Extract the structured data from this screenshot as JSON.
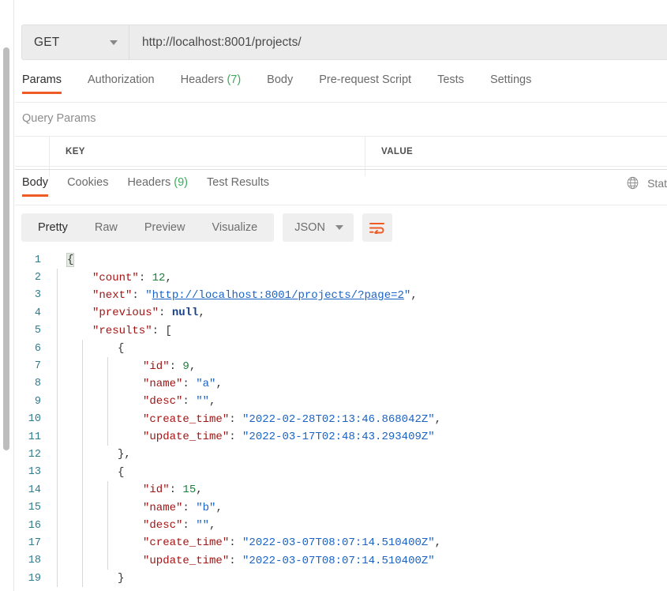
{
  "request": {
    "method": "GET",
    "url": "http://localhost:8001/projects/",
    "tabs": [
      {
        "label": "Params",
        "count": null,
        "active": true
      },
      {
        "label": "Authorization",
        "count": null,
        "active": false
      },
      {
        "label": "Headers",
        "count": "(7)",
        "active": false
      },
      {
        "label": "Body",
        "count": null,
        "active": false
      },
      {
        "label": "Pre-request Script",
        "count": null,
        "active": false
      },
      {
        "label": "Tests",
        "count": null,
        "active": false
      },
      {
        "label": "Settings",
        "count": null,
        "active": false
      }
    ],
    "query_params": {
      "title": "Query Params",
      "columns": [
        "KEY",
        "VALUE"
      ]
    }
  },
  "response": {
    "tabs": [
      {
        "label": "Body",
        "count": null,
        "active": true
      },
      {
        "label": "Cookies",
        "count": null,
        "active": false
      },
      {
        "label": "Headers",
        "count": "(9)",
        "active": false
      },
      {
        "label": "Test Results",
        "count": null,
        "active": false
      }
    ],
    "status_text": "Stat",
    "format_tabs": [
      {
        "label": "Pretty",
        "active": true
      },
      {
        "label": "Raw",
        "active": false
      },
      {
        "label": "Preview",
        "active": false
      },
      {
        "label": "Visualize",
        "active": false
      }
    ],
    "language": "JSON",
    "body_json": {
      "count": 12,
      "next": "http://localhost:8001/projects/?page=2",
      "previous": null,
      "results": [
        {
          "id": 9,
          "name": "a",
          "desc": "",
          "create_time": "2022-02-28T02:13:46.868042Z",
          "update_time": "2022-03-17T02:48:43.293409Z"
        },
        {
          "id": 15,
          "name": "b",
          "desc": "",
          "create_time": "2022-03-07T08:07:14.510400Z",
          "update_time": "2022-03-07T08:07:14.510400Z"
        }
      ]
    },
    "code_lines": [
      {
        "n": 1,
        "indent": 0,
        "guides": 0,
        "html": "<span class=\"tok-punc brace-hl\">{</span>"
      },
      {
        "n": 2,
        "indent": 1,
        "guides": 1,
        "html": "<span class=\"tok-key\">\"count\"</span><span class=\"tok-punc\">: </span><span class=\"tok-num\">12</span><span class=\"tok-punc\">,</span>"
      },
      {
        "n": 3,
        "indent": 1,
        "guides": 1,
        "html": "<span class=\"tok-key\">\"next\"</span><span class=\"tok-punc\">: </span><span class=\"tok-str\">\"</span><span class=\"tok-link\">http://localhost:8001/projects/?page=2</span><span class=\"tok-str\">\"</span><span class=\"tok-punc\">,</span>"
      },
      {
        "n": 4,
        "indent": 1,
        "guides": 1,
        "html": "<span class=\"tok-key\">\"previous\"</span><span class=\"tok-punc\">: </span><span class=\"tok-null\">null</span><span class=\"tok-punc\">,</span>"
      },
      {
        "n": 5,
        "indent": 1,
        "guides": 1,
        "html": "<span class=\"tok-key\">\"results\"</span><span class=\"tok-punc\">: [</span>"
      },
      {
        "n": 6,
        "indent": 2,
        "guides": 2,
        "html": "<span class=\"tok-punc\">{</span>"
      },
      {
        "n": 7,
        "indent": 3,
        "guides": 3,
        "html": "<span class=\"tok-key\">\"id\"</span><span class=\"tok-punc\">: </span><span class=\"tok-num\">9</span><span class=\"tok-punc\">,</span>"
      },
      {
        "n": 8,
        "indent": 3,
        "guides": 3,
        "html": "<span class=\"tok-key\">\"name\"</span><span class=\"tok-punc\">: </span><span class=\"tok-str\">\"a\"</span><span class=\"tok-punc\">,</span>"
      },
      {
        "n": 9,
        "indent": 3,
        "guides": 3,
        "html": "<span class=\"tok-key\">\"desc\"</span><span class=\"tok-punc\">: </span><span class=\"tok-str\">\"\"</span><span class=\"tok-punc\">,</span>"
      },
      {
        "n": 10,
        "indent": 3,
        "guides": 3,
        "html": "<span class=\"tok-key\">\"create_time\"</span><span class=\"tok-punc\">: </span><span class=\"tok-str\">\"2022-02-28T02:13:46.868042Z\"</span><span class=\"tok-punc\">,</span>"
      },
      {
        "n": 11,
        "indent": 3,
        "guides": 3,
        "html": "<span class=\"tok-key\">\"update_time\"</span><span class=\"tok-punc\">: </span><span class=\"tok-str\">\"2022-03-17T02:48:43.293409Z\"</span>"
      },
      {
        "n": 12,
        "indent": 2,
        "guides": 2,
        "html": "<span class=\"tok-punc\">},</span>"
      },
      {
        "n": 13,
        "indent": 2,
        "guides": 2,
        "html": "<span class=\"tok-punc\">{</span>"
      },
      {
        "n": 14,
        "indent": 3,
        "guides": 3,
        "html": "<span class=\"tok-key\">\"id\"</span><span class=\"tok-punc\">: </span><span class=\"tok-num\">15</span><span class=\"tok-punc\">,</span>"
      },
      {
        "n": 15,
        "indent": 3,
        "guides": 3,
        "html": "<span class=\"tok-key\">\"name\"</span><span class=\"tok-punc\">: </span><span class=\"tok-str\">\"b\"</span><span class=\"tok-punc\">,</span>"
      },
      {
        "n": 16,
        "indent": 3,
        "guides": 3,
        "html": "<span class=\"tok-key\">\"desc\"</span><span class=\"tok-punc\">: </span><span class=\"tok-str\">\"\"</span><span class=\"tok-punc\">,</span>"
      },
      {
        "n": 17,
        "indent": 3,
        "guides": 3,
        "html": "<span class=\"tok-key\">\"create_time\"</span><span class=\"tok-punc\">: </span><span class=\"tok-str\">\"2022-03-07T08:07:14.510400Z\"</span><span class=\"tok-punc\">,</span>"
      },
      {
        "n": 18,
        "indent": 3,
        "guides": 3,
        "html": "<span class=\"tok-key\">\"update_time\"</span><span class=\"tok-punc\">: </span><span class=\"tok-str\">\"2022-03-07T08:07:14.510400Z\"</span>"
      },
      {
        "n": 19,
        "indent": 2,
        "guides": 2,
        "html": "<span class=\"tok-punc\">}</span>"
      }
    ]
  },
  "colors": {
    "accent": "#ef5b25",
    "count_green": "#3bab5a",
    "json_key": "#a31515",
    "json_string": "#1b63c4",
    "json_number": "#1a7f37",
    "json_null": "#17408a",
    "line_number": "#2e7d8e"
  }
}
